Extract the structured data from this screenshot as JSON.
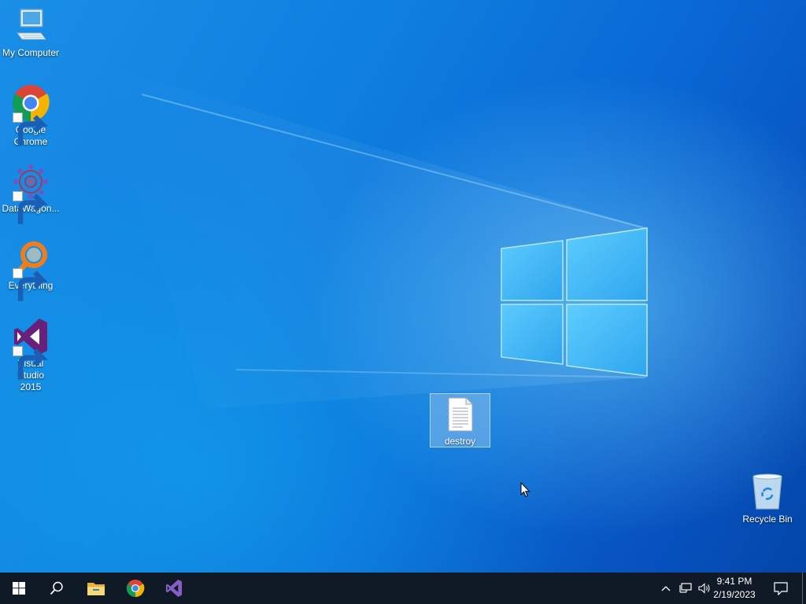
{
  "desktop": {
    "icons": [
      {
        "label": "My Computer",
        "icon": "computer-icon"
      },
      {
        "label": "Google Chrome",
        "icon": "chrome-icon"
      },
      {
        "label": "DataWagon...",
        "icon": "datawagon-icon"
      },
      {
        "label": "Everything",
        "icon": "everything-search-icon"
      },
      {
        "label": "Visual Studio 2015",
        "icon": "visual-studio-icon"
      },
      {
        "label": "destroy",
        "icon": "text-file-icon"
      },
      {
        "label": "Recycle Bin",
        "icon": "recycle-bin-icon"
      }
    ]
  },
  "taskbar": {
    "start": "windows-logo-icon",
    "search": "search-icon",
    "pinned": [
      "file-explorer-icon",
      "chrome-icon",
      "visual-studio-icon"
    ],
    "tray": [
      "chevron-up-icon",
      "network-icon",
      "volume-icon"
    ],
    "time": "9:41 PM",
    "date": "2/19/2023",
    "notification": "action-center-icon"
  },
  "colors": {
    "taskbar": "#101a27",
    "wallpaper_blue": "#0a6ad6",
    "vs_purple": "#68217a",
    "everything_orange": "#f07d1a"
  }
}
